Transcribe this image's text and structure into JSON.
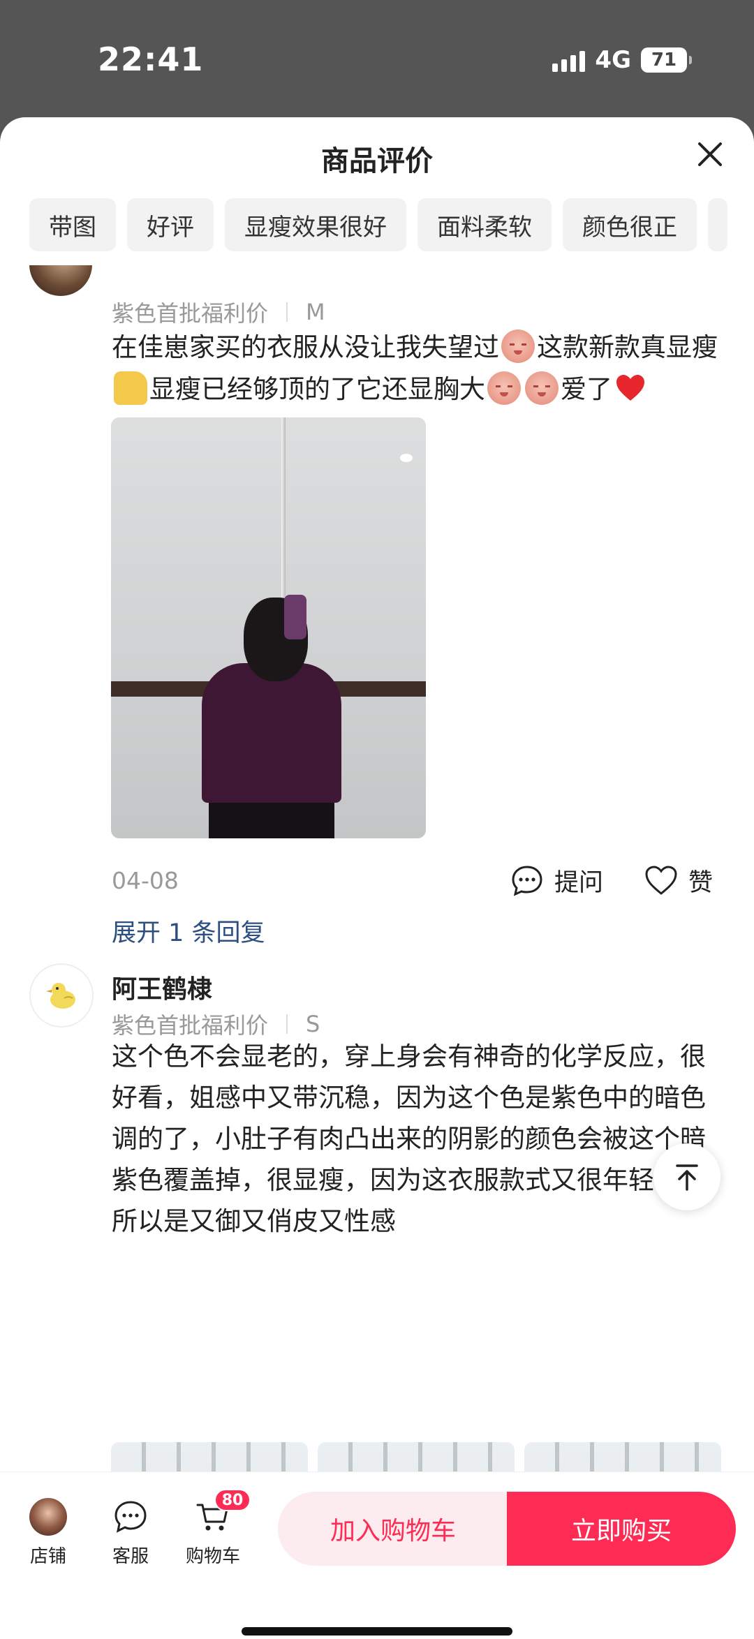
{
  "status_bar": {
    "time": "22:41",
    "network": "4G",
    "battery": "71"
  },
  "sheet": {
    "title": "商品评价"
  },
  "filters": [
    "带图",
    "好评",
    "显瘦效果很好",
    "面料柔软",
    "颜色很正"
  ],
  "review1": {
    "variant_color": "紫色首批福利价",
    "variant_size": "M",
    "text_parts": {
      "a": "在佳崽家买的衣服从没让我失望过",
      "b": "这款新款真显瘦",
      "c": "显瘦已经够顶的了它还显胸大",
      "d": "爱了"
    },
    "date": "04-08",
    "ask_label": "提问",
    "like_label": "赞",
    "expand_replies": "展开 1 条回复"
  },
  "review2": {
    "username": "阿王鹤棣",
    "variant_color": "紫色首批福利价",
    "variant_size": "S",
    "text": "这个色不会显老的，穿上身会有神奇的化学反应，很好看，姐感中又带沉稳，因为这个色是紫色中的暗色调的了，小肚子有肉凸出来的阴影的颜色会被这个暗紫色覆盖掉，很显瘦，因为这衣服款式又很年轻化，所以是又御又俏皮又性感"
  },
  "bottom_bar": {
    "store_label": "店铺",
    "service_label": "客服",
    "cart_label": "购物车",
    "cart_count": "80",
    "add_to_cart": "加入购物车",
    "buy_now": "立即购买"
  },
  "colors": {
    "accent": "#fe2c55",
    "link": "#2a4f80",
    "chip_bg": "#f2f2f2"
  }
}
